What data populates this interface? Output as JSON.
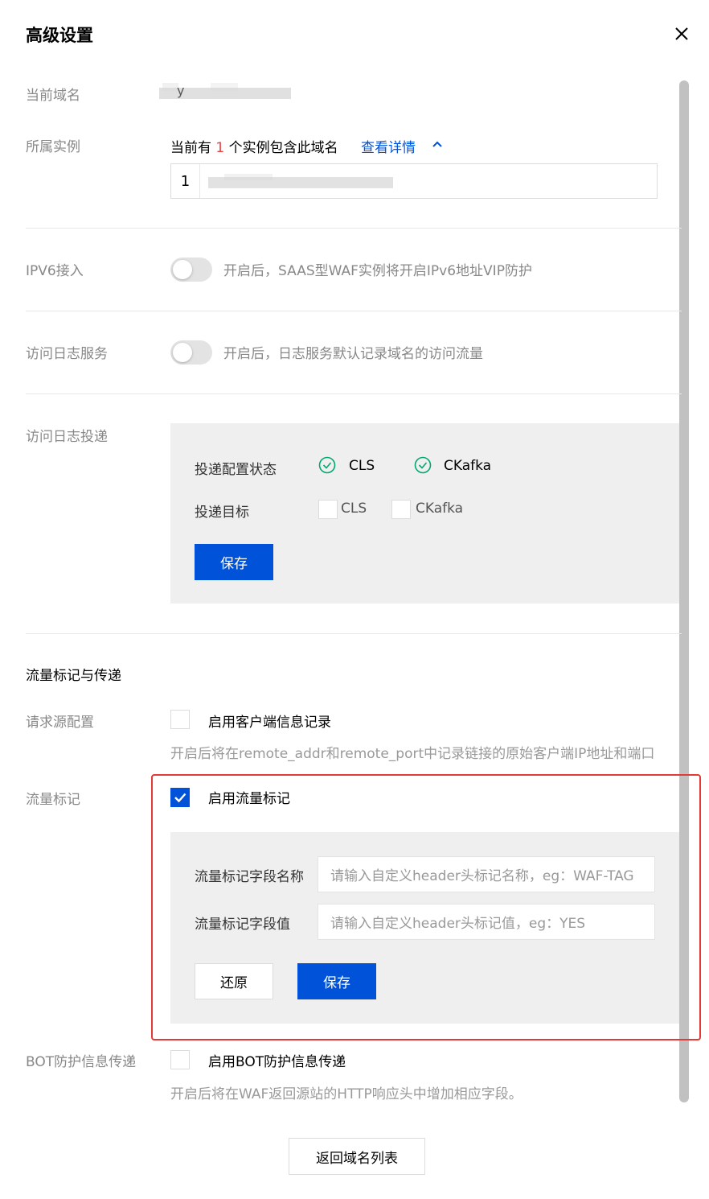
{
  "dialog": {
    "title": "高级设置",
    "close_icon": "close-icon"
  },
  "domain": {
    "label": "当前域名",
    "value_char": "y"
  },
  "instance": {
    "label": "所属实例",
    "prefix": "当前有",
    "count": "1",
    "suffix": "个实例包含此域名",
    "details_link": "查看详情",
    "row_index": "1"
  },
  "ipv6": {
    "label": "IPV6接入",
    "enabled": false,
    "description": "开启后，SAAS型WAF实例将开启IPv6地址VIP防护"
  },
  "access_log": {
    "label": "访问日志服务",
    "enabled": false,
    "description": "开启后，日志服务默认记录域名的访问流量"
  },
  "log_delivery": {
    "label": "访问日志投递",
    "status_label": "投递配置状态",
    "status_items": [
      "CLS",
      "CKafka"
    ],
    "target_label": "投递目标",
    "target_items": [
      "CLS",
      "CKafka"
    ],
    "save_label": "保存"
  },
  "traffic_section": {
    "heading": "流量标记与传递"
  },
  "request_source": {
    "label": "请求源配置",
    "checkbox_label": "启用客户端信息记录",
    "checked": false,
    "description": "开启后将在remote_addr和remote_port中记录链接的原始客户端IP地址和端口"
  },
  "traffic_mark": {
    "label": "流量标记",
    "checkbox_label": "启用流量标记",
    "checked": true,
    "field_name_label": "流量标记字段名称",
    "field_name_placeholder": "请输入自定义header头标记名称，eg：WAF-TAG",
    "field_value_label": "流量标记字段值",
    "field_value_placeholder": "请输入自定义header头标记值，eg：YES",
    "reset_label": "还原",
    "save_label": "保存"
  },
  "bot": {
    "label": "BOT防护信息传递",
    "checkbox_label": "启用BOT防护信息传递",
    "checked": false,
    "description": "开启后将在WAF返回源站的HTTP响应头中增加相应字段。"
  },
  "footer": {
    "back_label": "返回域名列表"
  },
  "colors": {
    "primary": "#0052d9",
    "success": "#00a870",
    "highlight": "#e53935",
    "count": "#e54545"
  }
}
